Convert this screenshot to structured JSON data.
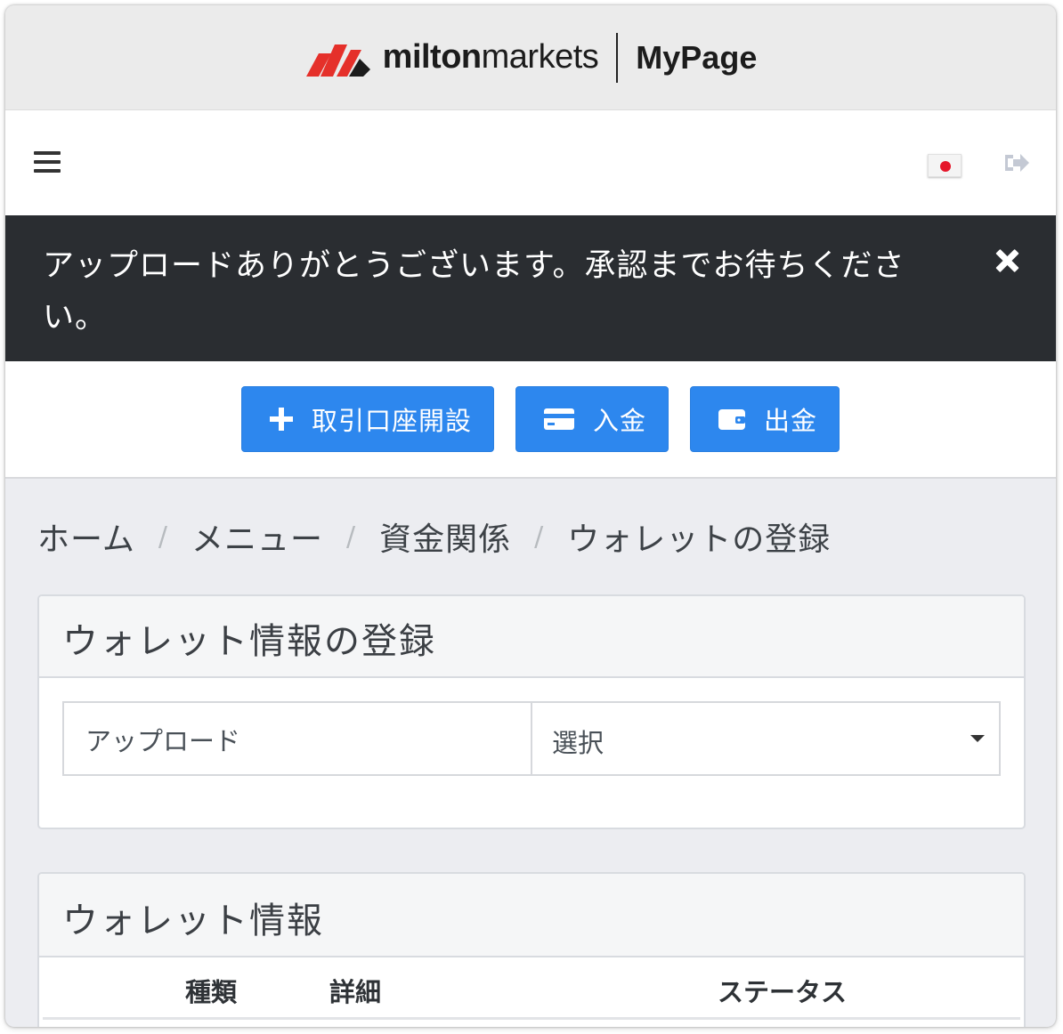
{
  "brand": {
    "name_bold": "milton",
    "name_light": "markets",
    "page": "MyPage",
    "colors": {
      "mark_red": "#e5302a",
      "mark_black": "#1c1c1c"
    }
  },
  "navbar": {
    "menu_icon": "hamburger-icon",
    "language_icon": "japan-flag-icon",
    "logout_icon": "sign-out-icon"
  },
  "alert": {
    "message": "アップロードありがとうございます。承認までお待ちください。",
    "close_icon": "close-icon"
  },
  "actions": {
    "open_account": "取引口座開設",
    "deposit": "入金",
    "withdraw": "出金",
    "icons": [
      "plus-icon",
      "credit-card-icon",
      "wallet-icon"
    ],
    "button_color": "#2d87ee"
  },
  "breadcrumb": {
    "items": [
      "ホーム",
      "メニュー",
      "資金関係"
    ],
    "active": "ウォレットの登録",
    "separator": "/"
  },
  "register_card": {
    "title": "ウォレット情報の登録",
    "upload_label": "アップロード",
    "select_value": "選択"
  },
  "wallet_card": {
    "title": "ウォレット情報",
    "columns": [
      "種類",
      "詳細",
      "ステータス"
    ]
  }
}
